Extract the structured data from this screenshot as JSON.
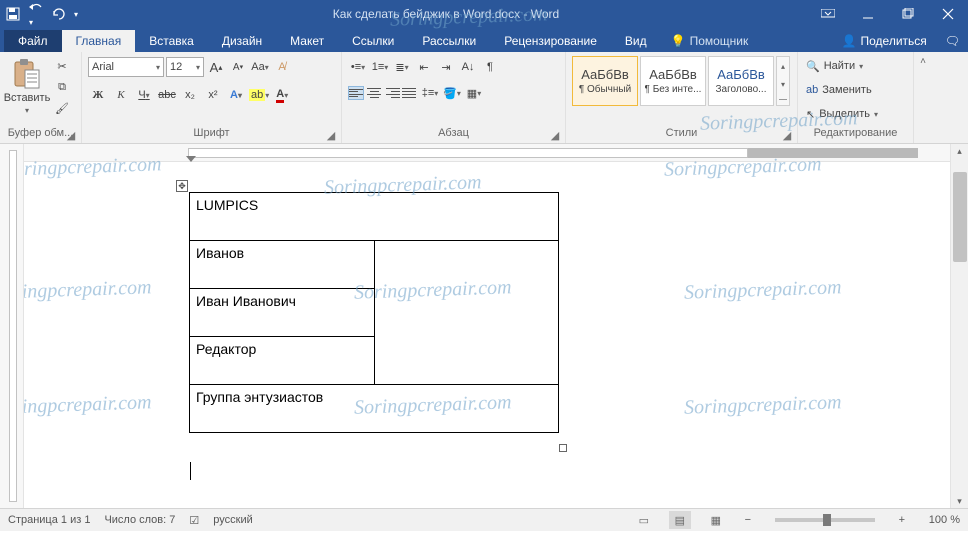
{
  "app": {
    "title": "Как сделать бейджик в Word.docx  -  Word"
  },
  "qat": {
    "save": "save",
    "undo": "undo",
    "redo": "redo"
  },
  "tabs": {
    "file": "Файл",
    "home": "Главная",
    "insert": "Вставка",
    "design": "Дизайн",
    "layout": "Макет",
    "references": "Ссылки",
    "mailings": "Рассылки",
    "review": "Рецензирование",
    "view": "Вид",
    "tell": "Помощник",
    "share": "Поделиться"
  },
  "ribbon": {
    "clipboard": {
      "paste": "Вставить",
      "label": "Буфер обм..."
    },
    "font": {
      "name": "Arial",
      "size": "12",
      "label": "Шрифт",
      "bold": "Ж",
      "italic": "К",
      "underline": "Ч",
      "strike": "abc",
      "sub": "x₂",
      "sup": "x²",
      "effects": "A",
      "highlight": "ab",
      "color": "A",
      "case": "Aa",
      "clear": "⌫",
      "inc": "A",
      "dec": "A"
    },
    "paragraph": {
      "label": "Абзац"
    },
    "styles": {
      "label": "Стили",
      "sample": "АаБбВв",
      "s1": "¶ Обычный",
      "s2": "¶ Без инте...",
      "s3": "Заголово..."
    },
    "editing": {
      "label": "Редактирование",
      "find": "Найти",
      "replace": "Заменить",
      "select": "Выделить"
    }
  },
  "doc": {
    "table": {
      "r1": "LUMPICS",
      "r2": "Иванов",
      "r3": "Иван Иванович",
      "r4": "Редактор",
      "r5": "Группа энтузиастов"
    }
  },
  "status": {
    "page": "Страница 1 из 1",
    "words": "Число слов: 7",
    "lang": "русский",
    "zoom": "100 %"
  },
  "watermark": "Soringpcrepair.com"
}
